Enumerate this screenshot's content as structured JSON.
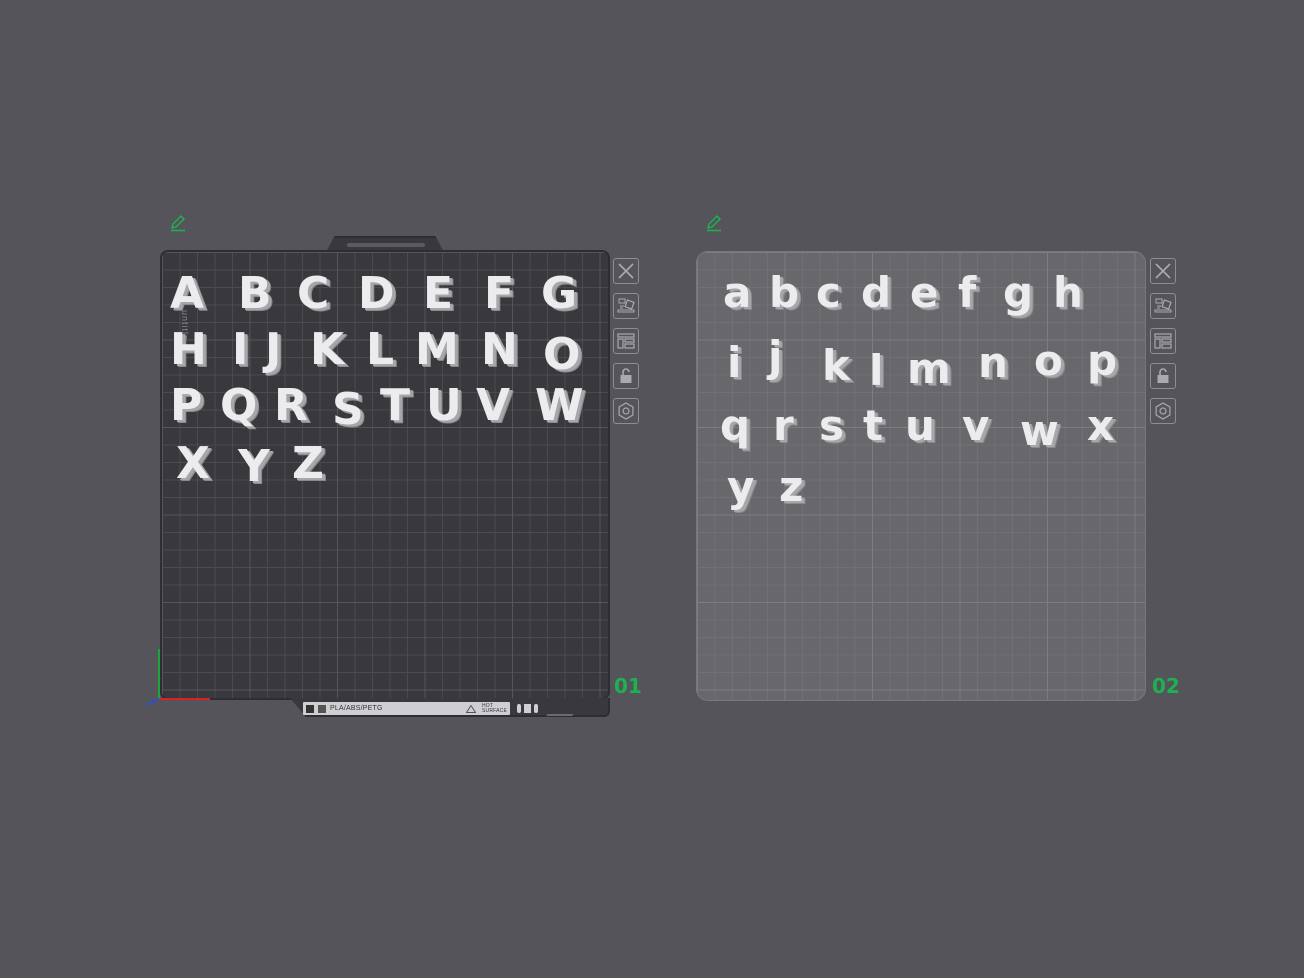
{
  "colors": {
    "background": "#54545a",
    "plate_number": "#1fb04f",
    "letter": "#ececee"
  },
  "plates": [
    {
      "number": "01",
      "label_strip": {
        "text": "PLA/ABS/PETG",
        "hot_line1": "HOT",
        "hot_line2": "SURFACE"
      },
      "side_text": "untitle",
      "letters": [
        "A",
        "B",
        "C",
        "D",
        "E",
        "F",
        "G",
        "H",
        "I",
        "J",
        "K",
        "L",
        "M",
        "N",
        "O",
        "P",
        "Q",
        "R",
        "S",
        "T",
        "U",
        "V",
        "W",
        "X",
        "Y",
        "Z"
      ]
    },
    {
      "number": "02",
      "letters": [
        "a",
        "b",
        "c",
        "d",
        "e",
        "f",
        "g",
        "h",
        "i",
        "j",
        "k",
        "l",
        "m",
        "n",
        "o",
        "p",
        "q",
        "r",
        "s",
        "t",
        "u",
        "v",
        "w",
        "x",
        "y",
        "z"
      ]
    }
  ],
  "tool_icons": [
    "close-icon",
    "arrange-icon",
    "layout-icon",
    "lock-icon",
    "settings-icon"
  ],
  "edit_icon": "pencil-icon"
}
